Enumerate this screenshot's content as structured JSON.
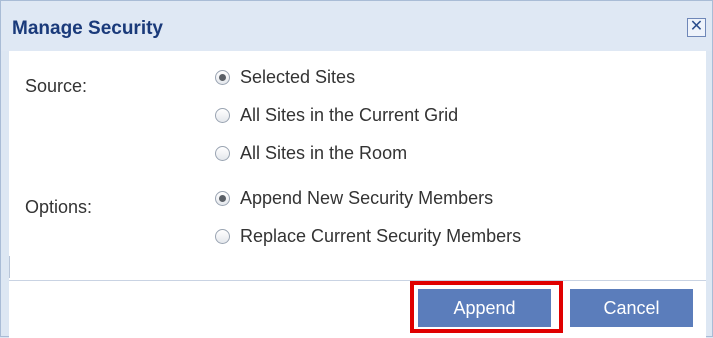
{
  "dialog": {
    "title": "Manage Security",
    "close_icon": "close-icon"
  },
  "source": {
    "label": "Source:",
    "options": [
      {
        "label": "Selected Sites",
        "checked": true
      },
      {
        "label": "All Sites in the Current Grid",
        "checked": false
      },
      {
        "label": "All Sites in the Room",
        "checked": false
      }
    ]
  },
  "options": {
    "label": "Options:",
    "options": [
      {
        "label": "Append New Security Members",
        "checked": true
      },
      {
        "label": "Replace Current Security Members",
        "checked": false
      }
    ]
  },
  "buttons": {
    "append": "Append",
    "cancel": "Cancel"
  },
  "colors": {
    "title": "#1a3a7a",
    "button": "#5b7dbb",
    "highlight": "#e00000"
  }
}
